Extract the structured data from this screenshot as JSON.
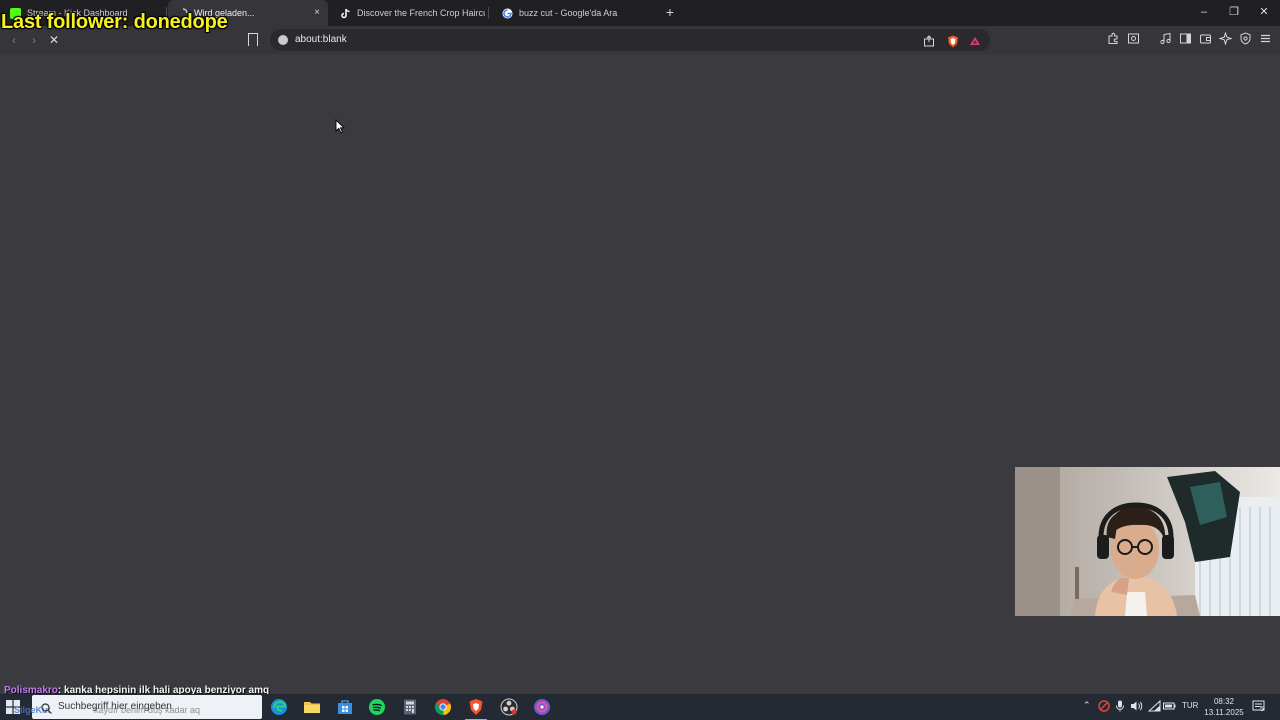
{
  "browser": {
    "tabs": [
      {
        "label": "Stream - Kick Dashboard",
        "favicon_color": "#53fc18",
        "active": false
      },
      {
        "label": "Wird geladen...",
        "favicon_color": "#cfcfd3",
        "active": true
      },
      {
        "label": "Discover the French Crop Haircut at I",
        "favicon_color": "#111111",
        "active": false
      },
      {
        "label": "buzz cut - Google'da Ara",
        "favicon_color": "#4285f4",
        "active": false
      }
    ],
    "close_glyph": "×",
    "newtab_glyph": "+",
    "url": "about:blank",
    "window_controls": [
      "–",
      "❐",
      "✕"
    ]
  },
  "overlay": {
    "last_follower": "Last follower: donedope"
  },
  "chat": {
    "user": "Polismakro",
    "message": ": kanka hepsinin ilk hali apoya benziyor amq"
  },
  "taskbar": {
    "search_placeholder": "Suchbegriff hier eingeben",
    "search_ghost_prefix": "SilgeKut",
    "search_ghost_suffix": "kaydır benim düş kadar aq",
    "tray_lang": "TUR",
    "clock_time": "08:32",
    "clock_date": "13.11.2025",
    "notif_count": "5"
  },
  "colors": {
    "page_bg": "#3b3b3f",
    "overlay_yellow": "#f7f21d",
    "chat_user": "#c27cf0"
  }
}
